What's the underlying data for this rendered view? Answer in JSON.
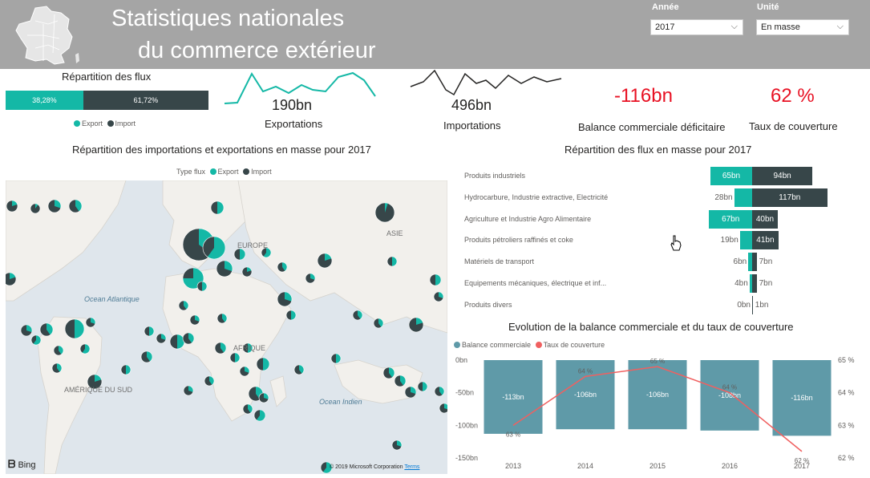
{
  "header": {
    "title_line1": "Statistiques nationales",
    "title_line2": "du commerce extérieur",
    "year_label": "Année",
    "year_value": "2017",
    "unit_label": "Unité",
    "unit_value": "En masse"
  },
  "flux": {
    "title": "Répartition des flux",
    "export_pct": "38,28%",
    "import_pct": "61,72%",
    "export_share": 0.3828,
    "legend_export": "Export",
    "legend_import": "Import"
  },
  "kpis": {
    "exports_value": "190bn",
    "exports_label": "Exportations",
    "imports_value": "496bn",
    "imports_label": "Importations",
    "balance_value": "-116bn",
    "balance_label": "Balance commerciale déficitaire",
    "coverage_value": "62 %",
    "coverage_label": "Taux de couverture"
  },
  "map": {
    "title": "Répartition des importations et exportations en masse pour 2017",
    "legend_title": "Type flux",
    "legend_export": "Export",
    "legend_import": "Import",
    "label_ocean_atl": "Ocean Atlantique",
    "label_ocean_ind": "Ocean Indien",
    "label_europe": "EUROPE",
    "label_asie": "ASIE",
    "label_afrique": "AFRIQUE",
    "label_amsud": "AMÉRIQUE DU SUD",
    "bing": "Bing",
    "copyright": "© 2019 Microsoft Corporation",
    "terms": "Terms"
  },
  "flows": {
    "title": "Répartition des flux en masse pour 2017",
    "rows": [
      {
        "label": "Produits industriels",
        "export": 65,
        "import": 94,
        "export_label": "65bn",
        "import_label": "94bn"
      },
      {
        "label": "Hydrocarbure, Industrie extractive, Electricité",
        "export": 28,
        "import": 117,
        "export_label": "28bn",
        "import_label": "117bn"
      },
      {
        "label": "Agriculture et Industrie Agro Alimentaire",
        "export": 67,
        "import": 40,
        "export_label": "67bn",
        "import_label": "40bn"
      },
      {
        "label": "Produits pétroliers raffinés et coke",
        "export": 19,
        "import": 41,
        "export_label": "19bn",
        "import_label": "41bn"
      },
      {
        "label": "Matériels de transport",
        "export": 6,
        "import": 7,
        "export_label": "6bn",
        "import_label": "7bn"
      },
      {
        "label": "Equipements mécaniques, électrique et inf...",
        "export": 4,
        "import": 7,
        "export_label": "4bn",
        "import_label": "7bn"
      },
      {
        "label": "Produits divers",
        "export": 0,
        "import": 1,
        "export_label": "0bn",
        "import_label": "1bn"
      }
    ]
  },
  "chart_data": {
    "type": "bar",
    "title": "Evolution de la balance commerciale et du taux de couverture",
    "categories": [
      "2013",
      "2014",
      "2015",
      "2016",
      "2017"
    ],
    "series": [
      {
        "name": "Balance commerciale",
        "kind": "bar",
        "values": [
          -113,
          -106,
          -106,
          -108,
          -116
        ],
        "labels": [
          "-113bn",
          "-106bn",
          "-106bn",
          "-108bn",
          "-116bn"
        ],
        "color": "#5f9aa8"
      },
      {
        "name": "Taux de couverture",
        "kind": "line",
        "values": [
          63,
          64.5,
          64.8,
          64.0,
          62.2
        ],
        "labels": [
          "63 %",
          "64 %",
          "65 %",
          "64 %",
          "62 %"
        ],
        "color": "#f06060"
      }
    ],
    "y_left_ticks": [
      "0bn",
      "-50bn",
      "-100bn",
      "-150bn"
    ],
    "y_left_lim": [
      -150,
      0
    ],
    "y_right_ticks": [
      "65 %",
      "64 %",
      "63 %",
      "62 %"
    ],
    "y_right_lim": [
      62,
      65
    ],
    "legend_position": "top-left"
  },
  "colors": {
    "export": "#14b8a6",
    "import": "#374649",
    "header": "#a5a5a5",
    "negative": "#e81123"
  }
}
